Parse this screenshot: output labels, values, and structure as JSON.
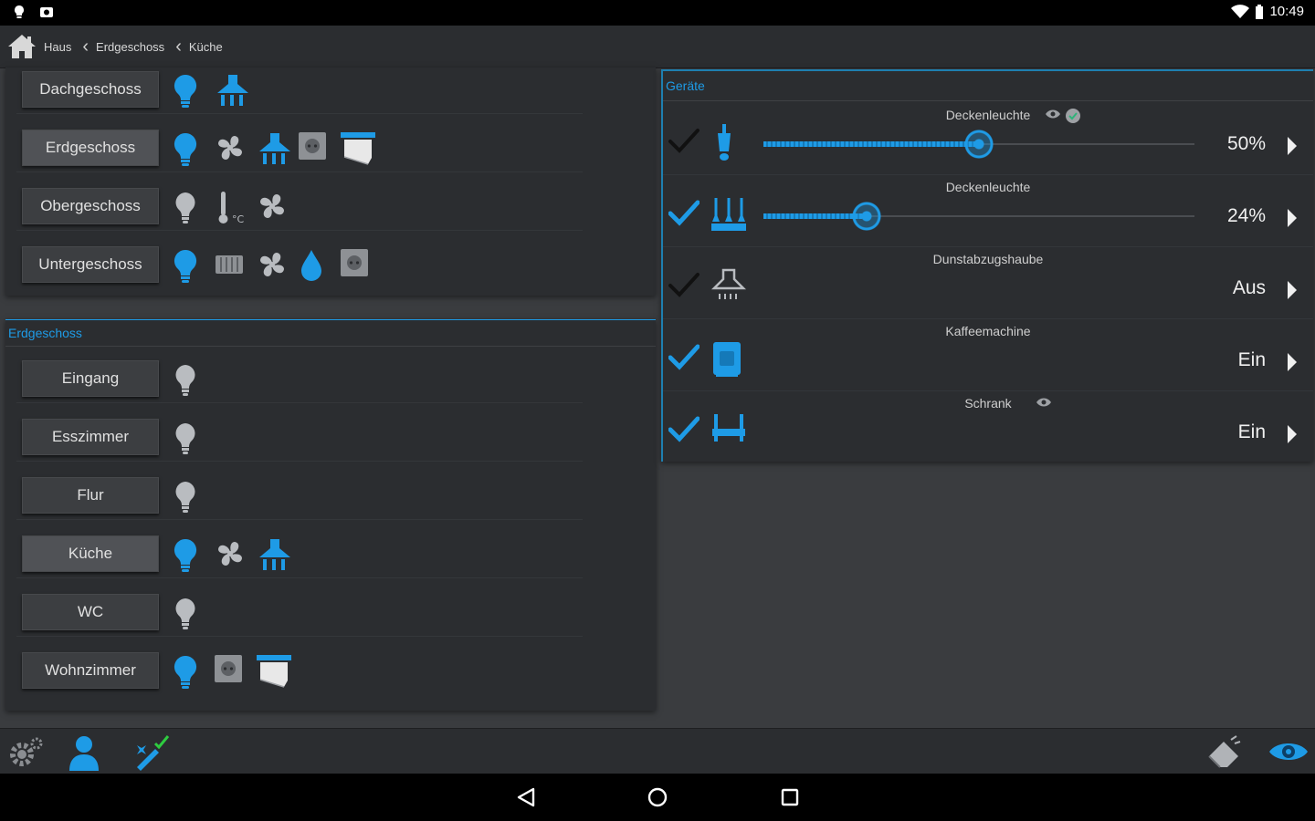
{
  "status": {
    "time": "10:49"
  },
  "breadcrumb": {
    "items": [
      "Haus",
      "Erdgeschoss",
      "Küche"
    ]
  },
  "floors": [
    {
      "label": "Dachgeschoss",
      "icons": [
        "bulb-on-icon",
        "cooker-hood-icon"
      ]
    },
    {
      "label": "Erdgeschoss",
      "active": true,
      "icons": [
        "bulb-on-icon",
        "fan-icon",
        "cooker-hood-icon",
        "socket-icon",
        "blinds-icon"
      ]
    },
    {
      "label": "Obergeschoss",
      "icons": [
        "bulb-off-icon",
        "thermometer-icon",
        "fan-icon"
      ]
    },
    {
      "label": "Untergeschoss",
      "icons": [
        "bulb-on-icon",
        "heater-icon",
        "fan-icon",
        "water-drop-icon",
        "socket-icon"
      ]
    }
  ],
  "rooms_panel": {
    "title": "Erdgeschoss"
  },
  "rooms": [
    {
      "label": "Eingang",
      "icons": [
        "bulb-off-icon"
      ]
    },
    {
      "label": "Esszimmer",
      "icons": [
        "bulb-off-icon"
      ]
    },
    {
      "label": "Flur",
      "icons": [
        "bulb-off-icon"
      ]
    },
    {
      "label": "Küche",
      "active": true,
      "icons": [
        "bulb-on-icon",
        "fan-icon",
        "cooker-hood-icon"
      ]
    },
    {
      "label": "WC",
      "icons": [
        "bulb-off-icon"
      ]
    },
    {
      "label": "Wohnzimmer",
      "icons": [
        "bulb-on-icon",
        "socket-icon",
        "blinds-icon"
      ]
    }
  ],
  "devices_panel": {
    "title": "Geräte"
  },
  "devices": [
    {
      "name": "Deckenleuchte",
      "value": "50%",
      "level": 0.5,
      "checked": false,
      "icon": "pendant-lamp-icon",
      "badges": [
        "eye-icon",
        "shield-icon"
      ]
    },
    {
      "name": "Deckenleuchte",
      "value": "24%",
      "level": 0.24,
      "checked": true,
      "icon": "ceiling-lamps-icon",
      "badges": []
    },
    {
      "name": "Dunstabzugshaube",
      "value": "Aus",
      "checked": false,
      "icon": "cooker-hood-icon",
      "badges": []
    },
    {
      "name": "Kaffeemachine",
      "value": "Ein",
      "checked": true,
      "icon": "coffee-machine-icon",
      "badges": []
    },
    {
      "name": "Schrank",
      "value": "Ein",
      "checked": true,
      "icon": "cabinet-icon",
      "badges": [
        "eye-icon"
      ]
    }
  ],
  "colors": {
    "accent": "#1e9be6",
    "panel": "#2b2d30",
    "background": "#3a3c3f"
  }
}
